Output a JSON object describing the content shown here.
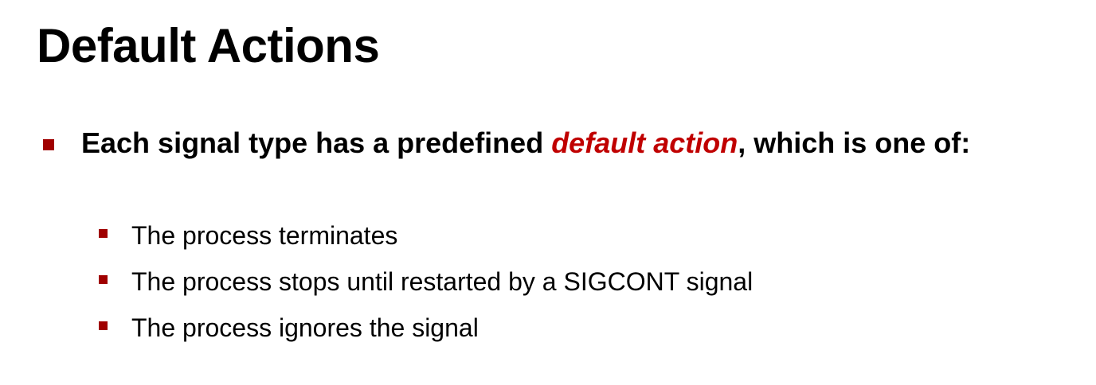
{
  "slide": {
    "title": "Default Actions",
    "main_bullet": {
      "text_before": "Each signal type has a predefined ",
      "emphasis": "default action",
      "text_after": ", which is one of:"
    },
    "sub_bullets": [
      "The process terminates",
      "The process stops until restarted by a SIGCONT signal",
      "The process ignores the signal"
    ]
  },
  "colors": {
    "accent": "#c00000",
    "bullet_marker": "#a00000",
    "text": "#000000",
    "background": "#ffffff"
  },
  "icons": {
    "bullet_marker": "square-bullet-icon"
  }
}
